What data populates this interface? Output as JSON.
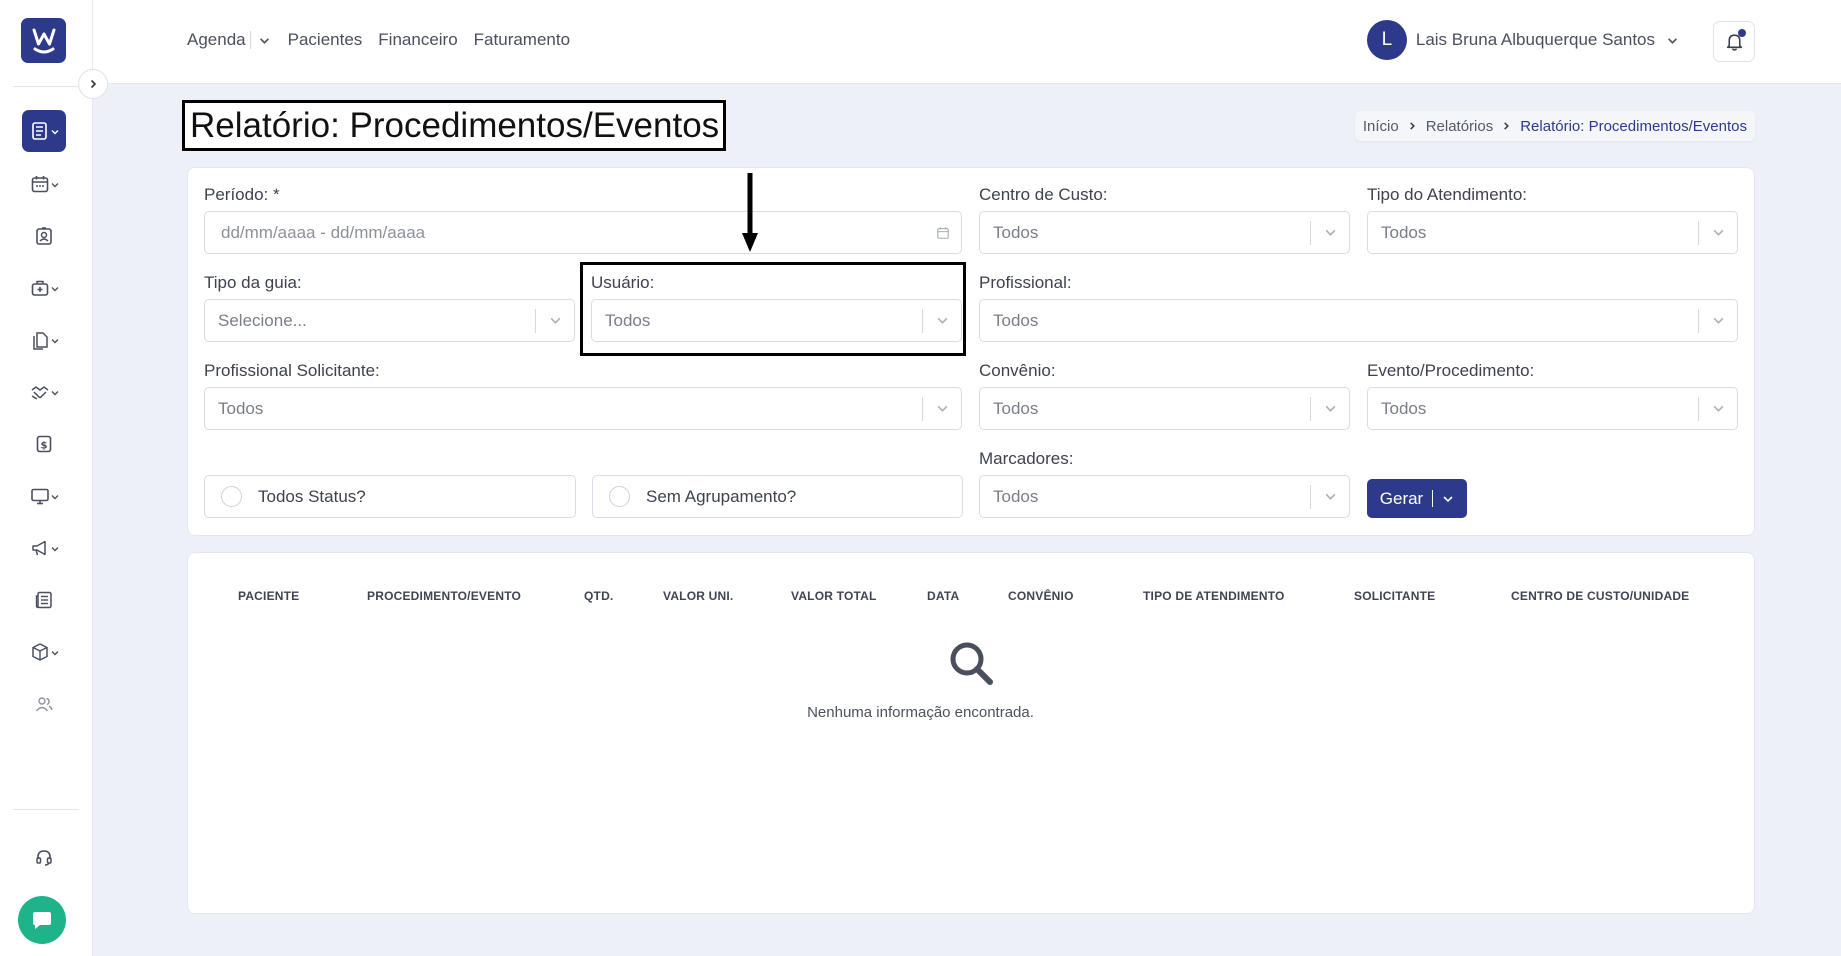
{
  "sidebar": {
    "logo_letter": "W",
    "items": [
      {
        "icon": "report-icon",
        "active": true,
        "has_caret": true
      },
      {
        "icon": "calendar-icon",
        "has_caret": true
      },
      {
        "icon": "patient-badge-icon",
        "has_caret": false
      },
      {
        "icon": "medical-kit-icon",
        "has_caret": true
      },
      {
        "icon": "documents-icon",
        "has_caret": true
      },
      {
        "icon": "handshake-icon",
        "has_caret": true
      },
      {
        "icon": "dollar-icon",
        "has_caret": false
      },
      {
        "icon": "monitor-icon",
        "has_caret": true
      },
      {
        "icon": "megaphone-icon",
        "has_caret": true
      },
      {
        "icon": "newspaper-icon",
        "has_caret": false
      },
      {
        "icon": "box-icon",
        "has_caret": true
      },
      {
        "icon": "users-icon",
        "has_caret": false
      }
    ],
    "support_icon": "headset-icon",
    "chat_icon": "chat-icon"
  },
  "header": {
    "nav": {
      "agenda": "Agenda",
      "pacientes": "Pacientes",
      "financeiro": "Financeiro",
      "faturamento": "Faturamento"
    },
    "user": {
      "initial": "L",
      "name": "Lais Bruna Albuquerque Santos"
    }
  },
  "page": {
    "title": "Relatório: Procedimentos/Eventos",
    "breadcrumb": {
      "home": "Início",
      "reports": "Relatórios",
      "current": "Relatório: Procedimentos/Eventos"
    }
  },
  "filters": {
    "periodo": {
      "label": "Período: *",
      "placeholder": "dd/mm/aaaa - dd/mm/aaaa"
    },
    "centro_custo": {
      "label": "Centro de Custo:",
      "value": "Todos"
    },
    "tipo_atendimento": {
      "label": "Tipo do Atendimento:",
      "value": "Todos"
    },
    "tipo_guia": {
      "label": "Tipo da guia:",
      "value": "Selecione..."
    },
    "usuario": {
      "label": "Usuário:",
      "value": "Todos"
    },
    "profissional": {
      "label": "Profissional:",
      "value": "Todos"
    },
    "profissional_solicitante": {
      "label": "Profissional Solicitante:",
      "value": "Todos"
    },
    "convenio": {
      "label": "Convênio:",
      "value": "Todos"
    },
    "evento_procedimento": {
      "label": "Evento/Procedimento:",
      "value": "Todos"
    },
    "marcadores": {
      "label": "Marcadores:",
      "value": "Todos"
    },
    "todos_status": {
      "label": "Todos Status?",
      "checked": false
    },
    "sem_agrupamento": {
      "label": "Sem Agrupamento?",
      "checked": false
    },
    "gerar_label": "Gerar"
  },
  "table": {
    "columns": [
      "PACIENTE",
      "PROCEDIMENTO/EVENTO",
      "QTD.",
      "VALOR UNI.",
      "VALOR TOTAL",
      "DATA",
      "CONVÊNIO",
      "TIPO DE ATENDIMENTO",
      "SOLICITANTE",
      "CENTRO DE CUSTO/UNIDADE"
    ],
    "empty_message": "Nenhuma informação encontrada."
  },
  "colors": {
    "primary": "#2d3a8c",
    "chat": "#1fb38a",
    "background": "#eef0f8"
  }
}
